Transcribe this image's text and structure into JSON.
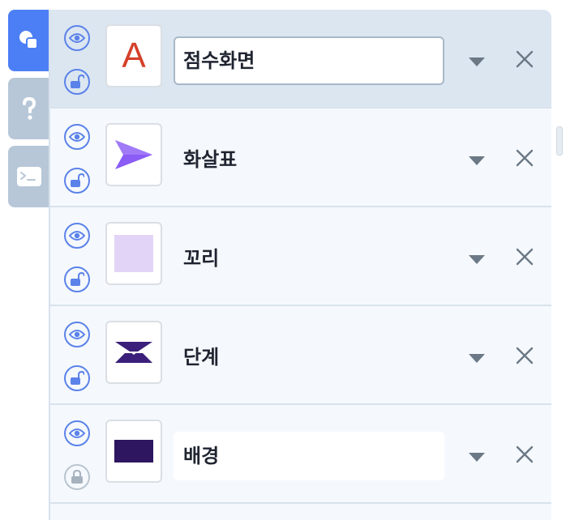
{
  "side_tabs": [
    {
      "icon": "shapes-icon",
      "active": true
    },
    {
      "icon": "question-icon",
      "active": false
    },
    {
      "icon": "terminal-icon",
      "active": false
    }
  ],
  "layers": [
    {
      "name": "점수화면",
      "thumbnail": "letter-a-thumbnail",
      "thumb_text": "A",
      "visible": true,
      "locked": false,
      "selected": true
    },
    {
      "name": "화살표",
      "thumbnail": "arrow-thumbnail",
      "visible": true,
      "locked": false,
      "selected": false
    },
    {
      "name": "꼬리",
      "thumbnail": "square-thumbnail",
      "visible": true,
      "locked": false,
      "selected": false
    },
    {
      "name": "단계",
      "thumbnail": "hourglass-thumbnail",
      "visible": true,
      "locked": false,
      "selected": false
    },
    {
      "name": "배경",
      "thumbnail": "dark-rect-thumbnail",
      "visible": true,
      "locked": true,
      "selected": false
    }
  ],
  "colors": {
    "accent": "#4c7ff5",
    "selected_row": "#dbe6f1",
    "row": "#f5f9fd",
    "letter_a": "#d4402a",
    "arrow": "#8b5cf6",
    "tail_square": "#e2d4f7",
    "hourglass": "#3b1f7a",
    "background_rect": "#2e1660"
  }
}
